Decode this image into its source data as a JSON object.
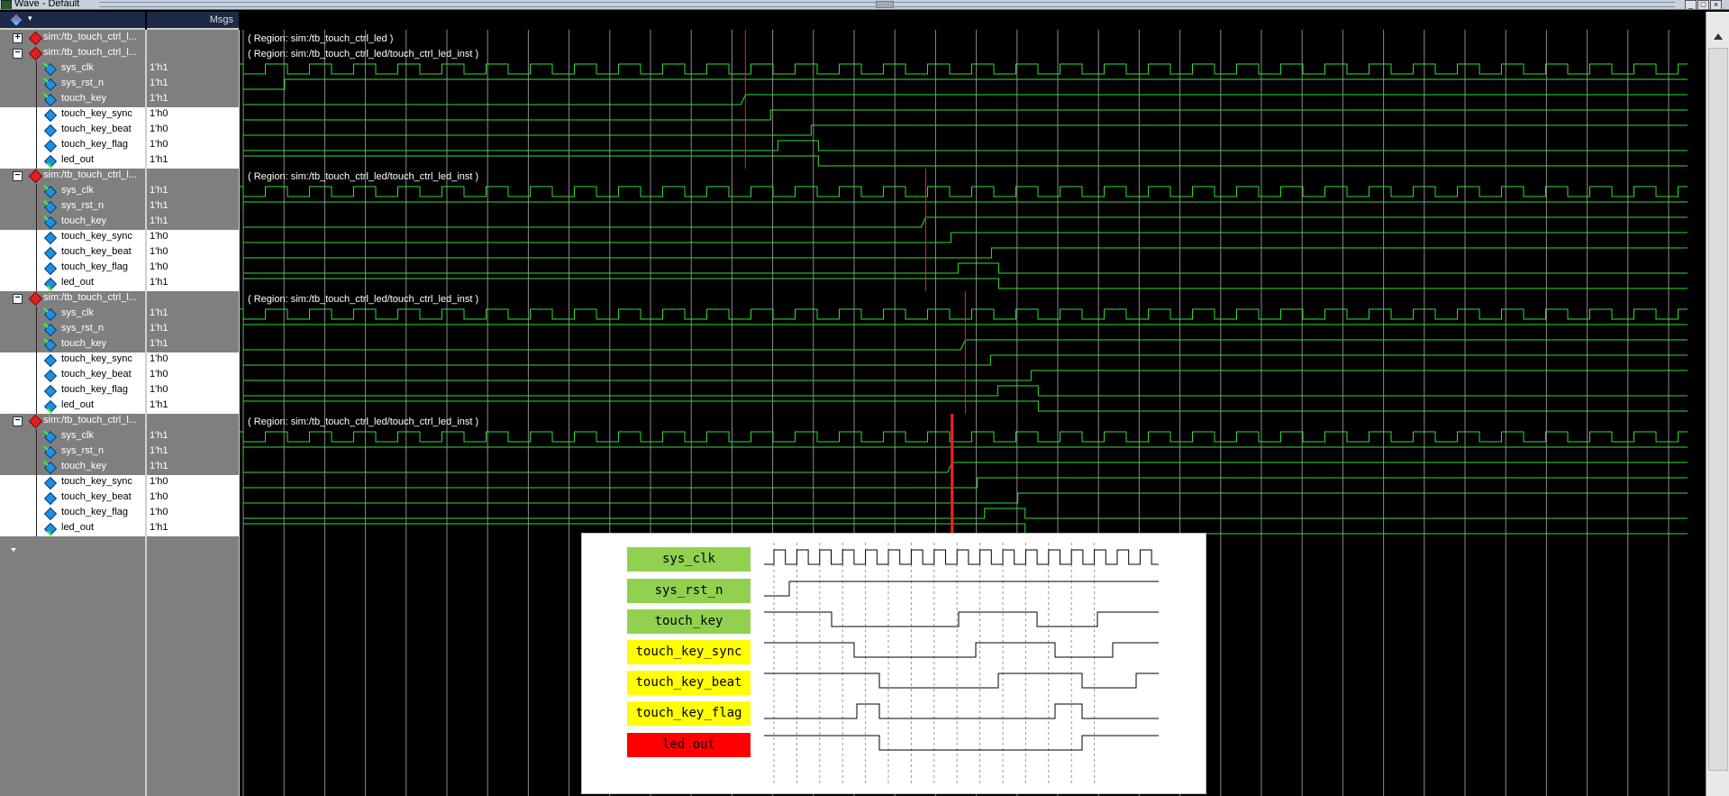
{
  "window": {
    "title": "Wave - Default",
    "controls": [
      "_",
      "□",
      "×"
    ]
  },
  "header": {
    "msgs_label": "Msgs"
  },
  "top_region": {
    "name": "sim:/tb_touch_ctrl_l...",
    "region_text": "( Region: sim:/tb_touch_ctrl_led )"
  },
  "groups": [
    {
      "name": "sim:/tb_touch_ctrl_l...",
      "region_text": "( Region: sim:/tb_touch_ctrl_led/touch_ctrl_led_inst )",
      "cursor_x_frac": 0.345,
      "signals": [
        {
          "name": "sys_clk",
          "value": "1'h1",
          "kind": "in"
        },
        {
          "name": "sys_rst_n",
          "value": "1'h1",
          "kind": "in"
        },
        {
          "name": "touch_key",
          "value": "1'h1",
          "kind": "in"
        },
        {
          "name": "touch_key_sync",
          "value": "1'h0",
          "kind": "internal"
        },
        {
          "name": "touch_key_beat",
          "value": "1'h0",
          "kind": "internal"
        },
        {
          "name": "touch_key_flag",
          "value": "1'h0",
          "kind": "internal"
        },
        {
          "name": "led_out",
          "value": "1'h1",
          "kind": "out"
        }
      ]
    },
    {
      "name": "sim:/tb_touch_ctrl_l...",
      "region_text": "( Region: sim:/tb_touch_ctrl_led/touch_ctrl_led_inst )",
      "cursor_x_frac": 0.468,
      "signals": [
        {
          "name": "sys_clk",
          "value": "1'h1",
          "kind": "in"
        },
        {
          "name": "sys_rst_n",
          "value": "1'h1",
          "kind": "in"
        },
        {
          "name": "touch_key",
          "value": "1'h1",
          "kind": "in"
        },
        {
          "name": "touch_key_sync",
          "value": "1'h0",
          "kind": "internal"
        },
        {
          "name": "touch_key_beat",
          "value": "1'h0",
          "kind": "internal"
        },
        {
          "name": "touch_key_flag",
          "value": "1'h0",
          "kind": "internal"
        },
        {
          "name": "led_out",
          "value": "1'h1",
          "kind": "out"
        }
      ]
    },
    {
      "name": "sim:/tb_touch_ctrl_l...",
      "region_text": "( Region: sim:/tb_touch_ctrl_led/touch_ctrl_led_inst )",
      "cursor_x_frac": 0.495,
      "signals": [
        {
          "name": "sys_clk",
          "value": "1'h1",
          "kind": "in"
        },
        {
          "name": "sys_rst_n",
          "value": "1'h1",
          "kind": "in"
        },
        {
          "name": "touch_key",
          "value": "1'h1",
          "kind": "in"
        },
        {
          "name": "touch_key_sync",
          "value": "1'h0",
          "kind": "internal"
        },
        {
          "name": "touch_key_beat",
          "value": "1'h0",
          "kind": "internal"
        },
        {
          "name": "touch_key_flag",
          "value": "1'h0",
          "kind": "internal"
        },
        {
          "name": "led_out",
          "value": "1'h1",
          "kind": "out"
        }
      ]
    },
    {
      "name": "sim:/tb_touch_ctrl_l...",
      "region_text": "( Region: sim:/tb_touch_ctrl_led/touch_ctrl_led_inst )",
      "cursor_x_frac": 0.486,
      "signals": [
        {
          "name": "sys_clk",
          "value": "1'h1",
          "kind": "in"
        },
        {
          "name": "sys_rst_n",
          "value": "1'h1",
          "kind": "in"
        },
        {
          "name": "touch_key",
          "value": "1'h1",
          "kind": "in"
        },
        {
          "name": "touch_key_sync",
          "value": "1'h0",
          "kind": "internal"
        },
        {
          "name": "touch_key_beat",
          "value": "1'h0",
          "kind": "internal"
        },
        {
          "name": "touch_key_flag",
          "value": "1'h0",
          "kind": "internal"
        },
        {
          "name": "led_out",
          "value": "1'h1",
          "kind": "out"
        }
      ]
    }
  ],
  "timing_diagram": {
    "signals": [
      {
        "name": "sys_clk",
        "color": "#92d050"
      },
      {
        "name": "sys_rst_n",
        "color": "#92d050"
      },
      {
        "name": "touch_key",
        "color": "#92d050"
      },
      {
        "name": "touch_key_sync",
        "color": "#ffff00"
      },
      {
        "name": "touch_key_beat",
        "color": "#ffff00"
      },
      {
        "name": "touch_key_flag",
        "color": "#ffff00"
      },
      {
        "name": "led_out",
        "color": "#ff0000"
      }
    ]
  },
  "colors": {
    "wave": "#33dd33",
    "cursor": "#ff2020",
    "grid": "#8a8a8a",
    "pane_bg": "#7f7f7f"
  }
}
